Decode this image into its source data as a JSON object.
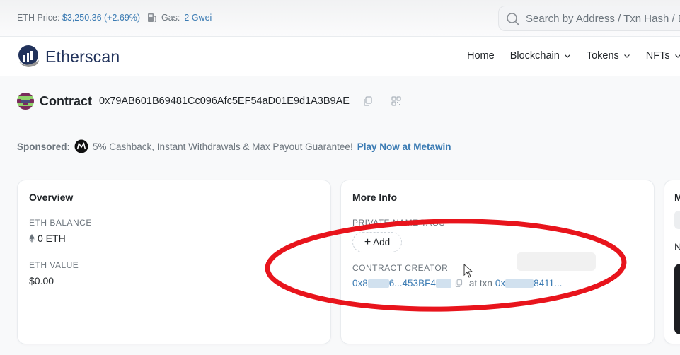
{
  "topbar": {
    "eth_price_label": "ETH Price:",
    "eth_price_value": "$3,250.36 (+2.69%)",
    "gas_icon": "gas-pump-icon",
    "gas_label": "Gas:",
    "gas_value": "2 Gwei",
    "search_placeholder": "Search by Address / Txn Hash / Block / Token / Domain Name"
  },
  "nav": {
    "brand": "Etherscan",
    "items": [
      {
        "label": "Home",
        "dropdown": false
      },
      {
        "label": "Blockchain",
        "dropdown": true
      },
      {
        "label": "Tokens",
        "dropdown": true
      },
      {
        "label": "NFTs",
        "dropdown": true
      }
    ]
  },
  "contract": {
    "title": "Contract",
    "address": "0x79AB601B69481Cc096Afc5EF54aD01E9d1A3B9AE",
    "icons": [
      "copy-icon",
      "qr-code-icon"
    ]
  },
  "sponsored": {
    "label": "Sponsored:",
    "text": "5% Cashback, Instant Withdrawals & Max Payout Guarantee!",
    "cta": "Play Now at Metawin"
  },
  "overview": {
    "title": "Overview",
    "eth_balance_label": "ETH BALANCE",
    "eth_balance_value": "0 ETH",
    "eth_value_label": "ETH VALUE",
    "eth_value_value": "$0.00"
  },
  "more_info": {
    "title": "More Info",
    "private_name_tags_label": "PRIVATE NAME TAGS",
    "add_label": "Add",
    "contract_creator_label": "CONTRACT CREATOR",
    "creator_address_prefix": "0x8",
    "creator_address_suffix": "6...453BF4",
    "at_txn_label": "at txn",
    "txn_prefix": "0x",
    "txn_suffix": "8411..."
  },
  "third_card": {
    "title_partial": "M",
    "subtitle_partial": "N"
  },
  "colors": {
    "link": "#3b7bb3",
    "brand_navy": "#21325b",
    "annotation_red": "#e8141c"
  }
}
